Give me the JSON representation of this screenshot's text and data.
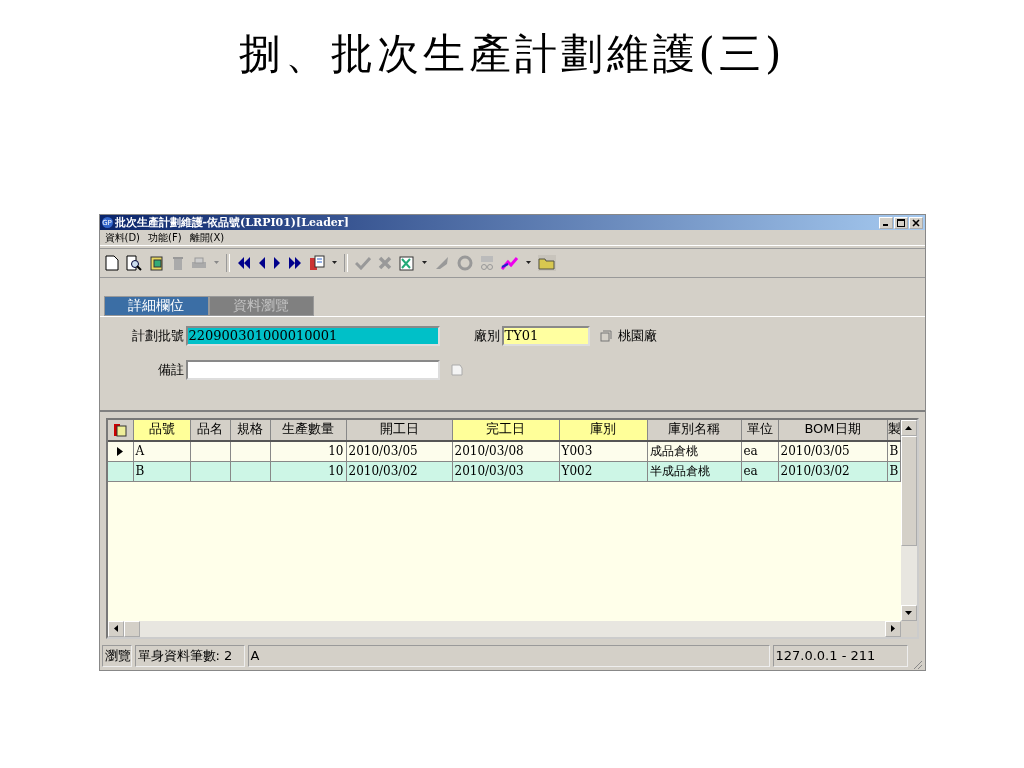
{
  "slide_title": "捌、批次生產計劃維護(三)",
  "window": {
    "title": "批次生產計劃維護-依品號(LRPI01)[Leader]",
    "app_badge": "GP"
  },
  "menu": [
    "資料(D)",
    "功能(F)",
    "離開(X)"
  ],
  "tabs": [
    {
      "label": "詳細欄位",
      "selected": true
    },
    {
      "label": "資料瀏覽",
      "selected": false
    }
  ],
  "form": {
    "plan_batch": {
      "label": "計劃批號",
      "value": "220900301000010001"
    },
    "factory": {
      "label": "廠別",
      "value": "TY01",
      "name": "桃園廠"
    },
    "remark": {
      "label": "備註"
    }
  },
  "table": {
    "columns": [
      {
        "label": "品號",
        "highlighted": true,
        "kind": "text"
      },
      {
        "label": "品名",
        "highlighted": false,
        "kind": "text"
      },
      {
        "label": "規格",
        "highlighted": false,
        "kind": "text"
      },
      {
        "label": "生產數量",
        "highlighted": false,
        "kind": "number"
      },
      {
        "label": "開工日",
        "highlighted": false,
        "kind": "text"
      },
      {
        "label": "完工日",
        "highlighted": true,
        "kind": "text"
      },
      {
        "label": "庫別",
        "highlighted": true,
        "kind": "text"
      },
      {
        "label": "庫別名稱",
        "highlighted": false,
        "kind": "text"
      },
      {
        "label": "單位",
        "highlighted": false,
        "kind": "text"
      },
      {
        "label": "BOM日期",
        "highlighted": false,
        "kind": "text"
      },
      {
        "label": "製",
        "highlighted": false,
        "kind": "text"
      }
    ],
    "rows": [
      {
        "current": true,
        "color": "#fdfdec",
        "cells": [
          "A",
          "",
          "",
          "10",
          "2010/03/05",
          "2010/03/08",
          "Y003",
          "成品倉桃",
          "ea",
          "2010/03/05",
          "B"
        ]
      },
      {
        "current": false,
        "color": "#cdf6e6",
        "cells": [
          "B",
          "",
          "",
          "10",
          "2010/03/02",
          "2010/03/03",
          "Y002",
          "半成品倉桃",
          "ea",
          "2010/03/02",
          "B"
        ]
      }
    ]
  },
  "status_bar": [
    "瀏覽",
    "單身資料筆數: 2",
    "A",
    "127.0.0.1 - 211"
  ]
}
